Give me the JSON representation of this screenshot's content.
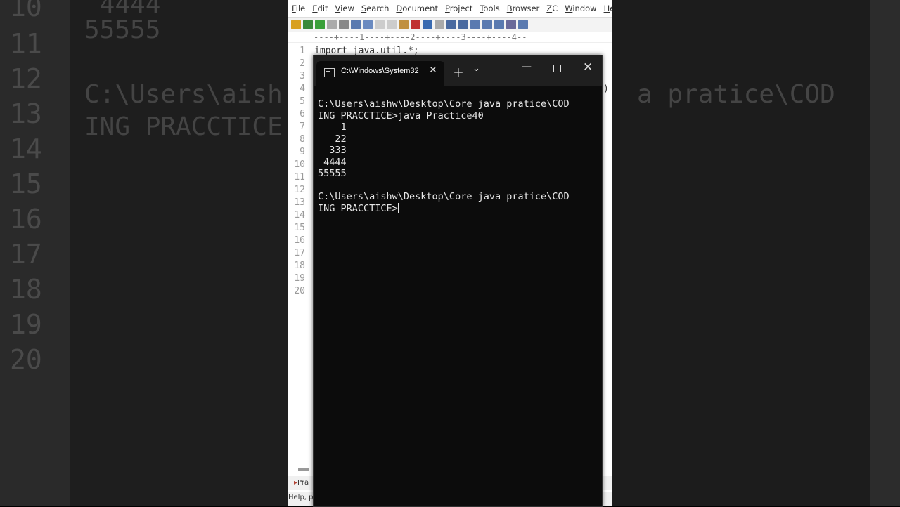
{
  "background": {
    "line_numbers": [
      "10",
      "11",
      "12",
      "13",
      "14",
      "15",
      "16",
      "17",
      "18",
      "19",
      "20"
    ],
    "text_lines": [
      " 4444",
      "55555",
      "",
      "C:\\Users\\aish",
      "ING PRACCTICE"
    ],
    "right_text": "a pratice\\COD"
  },
  "editor": {
    "menu": [
      "File",
      "Edit",
      "View",
      "Search",
      "Document",
      "Project",
      "Tools",
      "Browser",
      "ZC",
      "Window",
      "Help"
    ],
    "ruler": "----+----1----+----2----+----3----+----4--",
    "lines": [
      {
        "n": "1",
        "code": "import java.util.*;"
      },
      {
        "n": "2",
        "code": ""
      },
      {
        "n": "3",
        "code": ""
      },
      {
        "n": "4",
        "code": ""
      },
      {
        "n": "5",
        "code": ""
      },
      {
        "n": "6",
        "code": ""
      },
      {
        "n": "7",
        "code": ""
      },
      {
        "n": "8",
        "code": ""
      },
      {
        "n": "9",
        "code": ""
      },
      {
        "n": "10",
        "code": ""
      },
      {
        "n": "11",
        "code": ""
      },
      {
        "n": "12",
        "code": ""
      },
      {
        "n": "13",
        "code": ""
      },
      {
        "n": "14",
        "code": ""
      },
      {
        "n": "15",
        "code": ""
      },
      {
        "n": "16",
        "code": ""
      },
      {
        "n": "17",
        "code": ""
      },
      {
        "n": "18",
        "code": ""
      },
      {
        "n": "19",
        "code": ""
      },
      {
        "n": "20",
        "code": ""
      }
    ],
    "line4_tail": ")",
    "tab_label": "Pra",
    "status": "Help, pro"
  },
  "terminal": {
    "tab_title": "C:\\Windows\\System32",
    "console_lines": [
      "C:\\Users\\aishw\\Desktop\\Core java pratice\\COD",
      "ING PRACCTICE>java Practice40",
      "    1",
      "   22",
      "  333",
      " 4444",
      "55555",
      "",
      "C:\\Users\\aishw\\Desktop\\Core java pratice\\COD",
      "ING PRACCTICE>"
    ]
  }
}
